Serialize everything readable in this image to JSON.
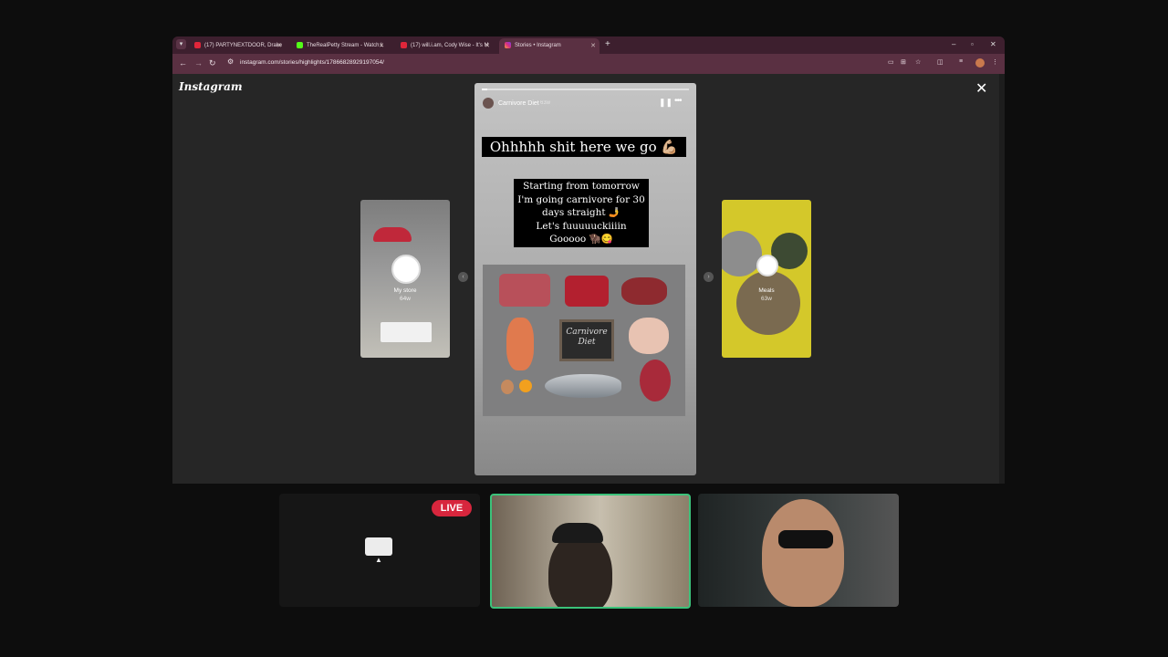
{
  "browser": {
    "tabs": [
      {
        "title": "(17) PARTYNEXTDOOR, Drake"
      },
      {
        "title": "TheRealPetty Stream - Watch L"
      },
      {
        "title": "(17) will.i.am, Cody Wise - It's M"
      },
      {
        "title": "Stories • Instagram"
      }
    ],
    "url": "instagram.com/stories/highlights/17866828929197054/",
    "icons": {
      "back": "arrow-left-icon",
      "forward": "arrow-right-icon",
      "reload": "reload-icon",
      "new_tab": "plus-icon"
    },
    "accent_colors": {
      "tabbar": "#3d1f2e",
      "toolbar": "#5a3042"
    }
  },
  "instagram": {
    "logo": "Instagram",
    "close_symbol": "✕",
    "current_story": {
      "account": "Carnivore Diet",
      "time": "63w",
      "headline": "Ohhhhh shit here we go 💪🏼",
      "text_lines": [
        "Starting from tomorrow",
        "I'm going carnivore for 30",
        "days straight 🤳",
        "Let's fuuuuuckiiiin",
        "Gooooo 🦬😋"
      ],
      "sign_lines": [
        "Carnivore",
        "Diet"
      ]
    },
    "previous_story": {
      "label": "My store",
      "sub": "64w"
    },
    "next_story": {
      "label": "Meals",
      "sub": "63w"
    }
  },
  "stream": {
    "live_badge": "LIVE",
    "accent_colors": {
      "live": "#d7263d",
      "active_speaker_border": "#3bc27a"
    }
  }
}
